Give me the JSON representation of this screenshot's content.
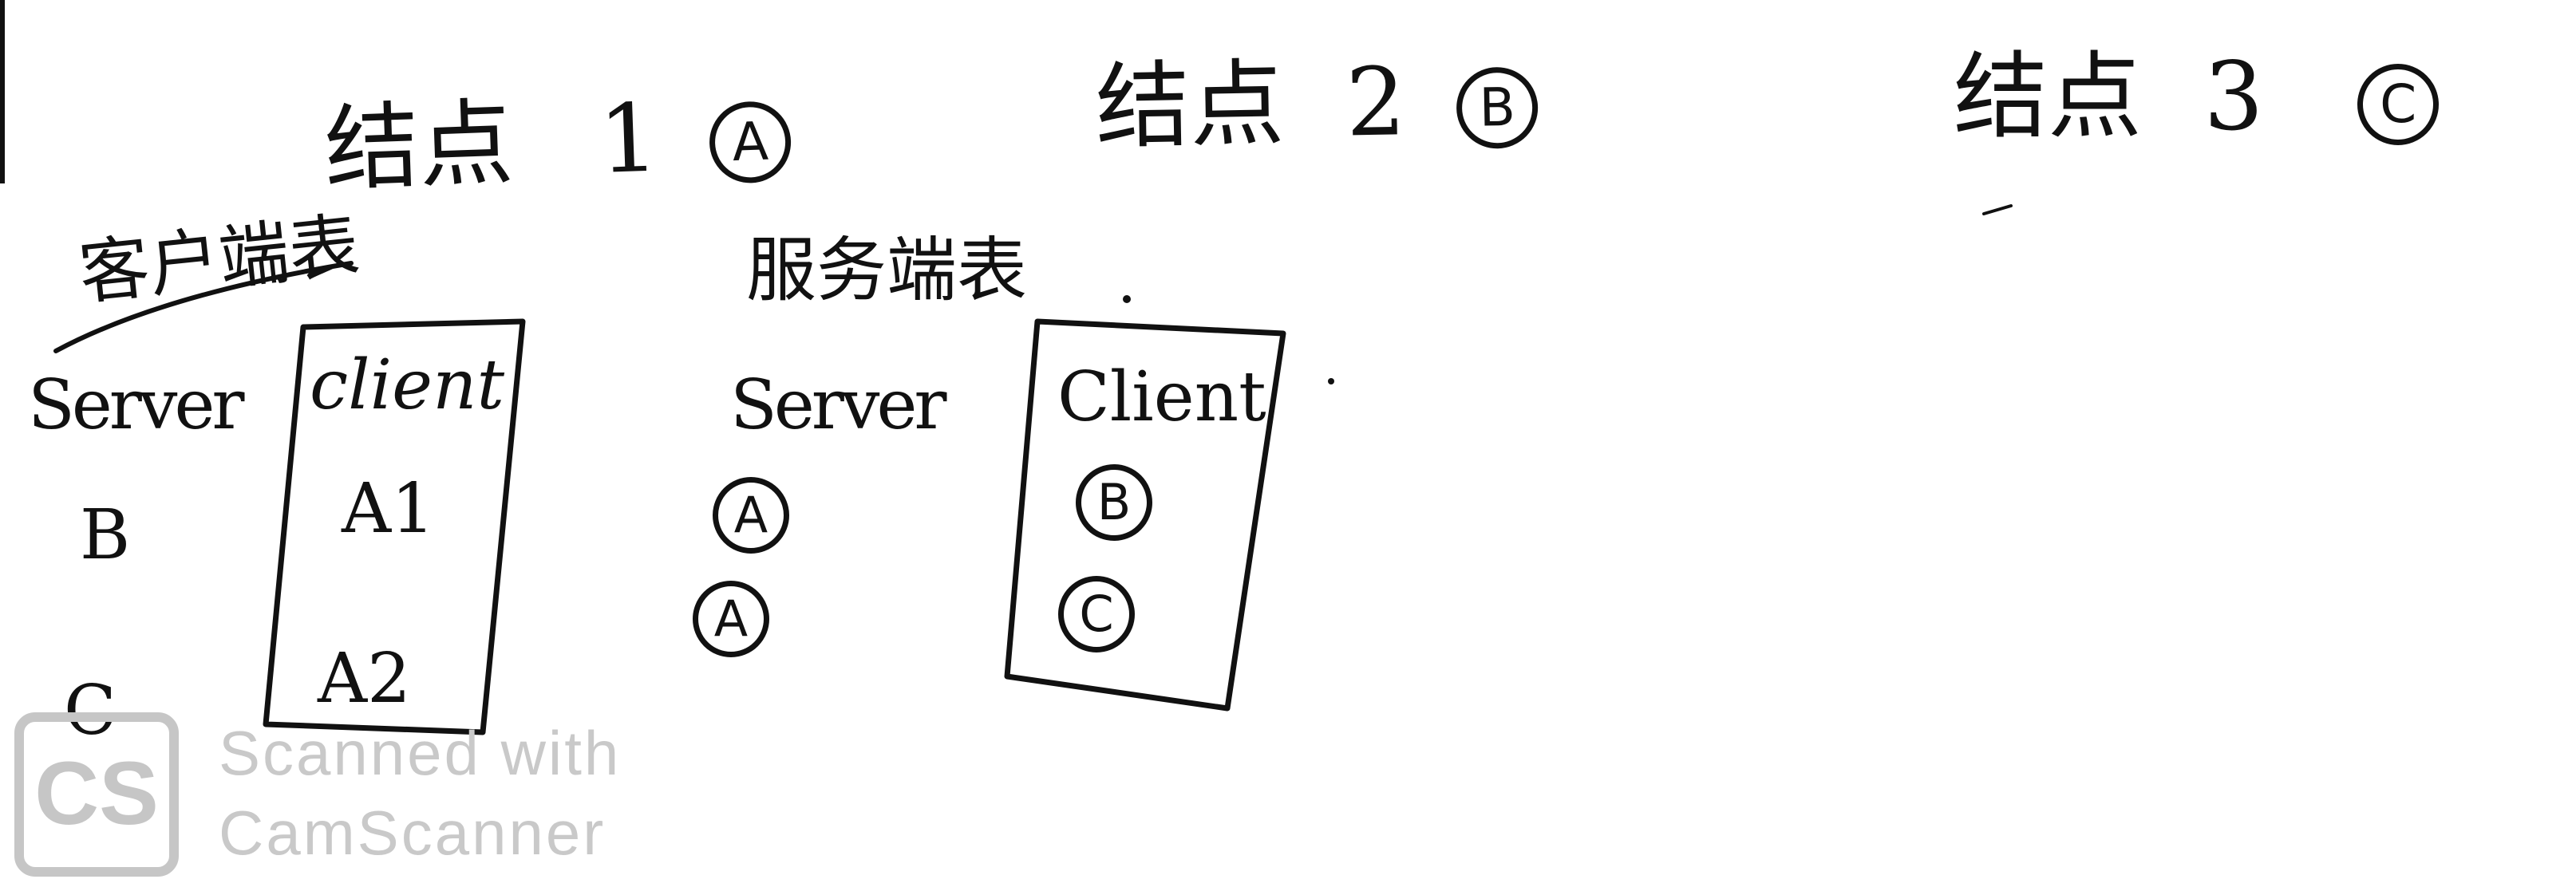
{
  "nodes": [
    {
      "label": "结点",
      "number": "1",
      "circled": "A"
    },
    {
      "label": "结点",
      "number": "2",
      "circled": "B"
    },
    {
      "label": "结点",
      "number": "3",
      "circled": "C"
    }
  ],
  "client_table": {
    "title": "客户端表",
    "server_header": "Server",
    "client_header": "client",
    "server_values": [
      "B",
      "C"
    ],
    "client_values": [
      "A1",
      "A2"
    ]
  },
  "server_table": {
    "title": "服务端表",
    "server_header": "Server",
    "client_header": "Client",
    "server_values": [
      "A",
      "A"
    ],
    "client_values": [
      "B",
      "C"
    ]
  },
  "watermark": {
    "logo": "CS",
    "line1": "Scanned with",
    "line2": "CamScanner"
  }
}
